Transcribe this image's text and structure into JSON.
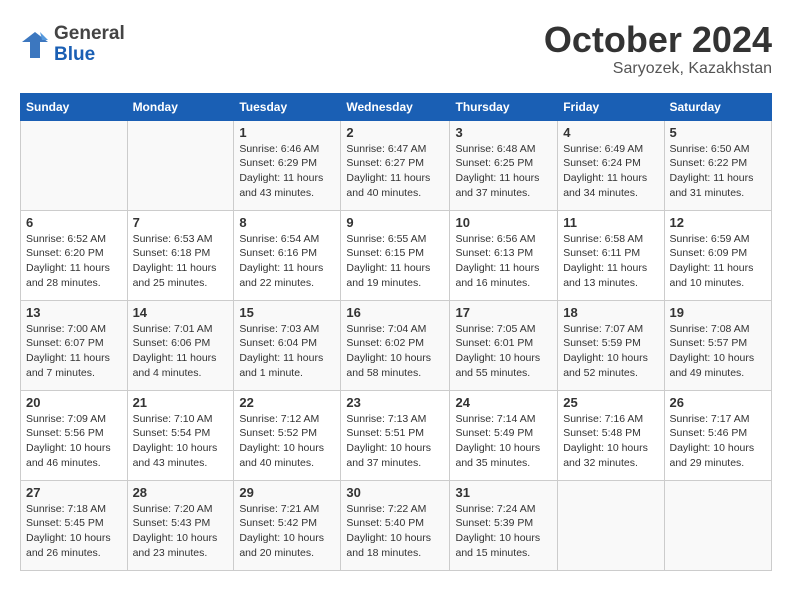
{
  "header": {
    "logo_general": "General",
    "logo_blue": "Blue",
    "month": "October 2024",
    "location": "Saryozek, Kazakhstan"
  },
  "weekdays": [
    "Sunday",
    "Monday",
    "Tuesday",
    "Wednesday",
    "Thursday",
    "Friday",
    "Saturday"
  ],
  "weeks": [
    [
      {
        "day": "",
        "info": ""
      },
      {
        "day": "",
        "info": ""
      },
      {
        "day": "1",
        "info": "Sunrise: 6:46 AM\nSunset: 6:29 PM\nDaylight: 11 hours and 43 minutes."
      },
      {
        "day": "2",
        "info": "Sunrise: 6:47 AM\nSunset: 6:27 PM\nDaylight: 11 hours and 40 minutes."
      },
      {
        "day": "3",
        "info": "Sunrise: 6:48 AM\nSunset: 6:25 PM\nDaylight: 11 hours and 37 minutes."
      },
      {
        "day": "4",
        "info": "Sunrise: 6:49 AM\nSunset: 6:24 PM\nDaylight: 11 hours and 34 minutes."
      },
      {
        "day": "5",
        "info": "Sunrise: 6:50 AM\nSunset: 6:22 PM\nDaylight: 11 hours and 31 minutes."
      }
    ],
    [
      {
        "day": "6",
        "info": "Sunrise: 6:52 AM\nSunset: 6:20 PM\nDaylight: 11 hours and 28 minutes."
      },
      {
        "day": "7",
        "info": "Sunrise: 6:53 AM\nSunset: 6:18 PM\nDaylight: 11 hours and 25 minutes."
      },
      {
        "day": "8",
        "info": "Sunrise: 6:54 AM\nSunset: 6:16 PM\nDaylight: 11 hours and 22 minutes."
      },
      {
        "day": "9",
        "info": "Sunrise: 6:55 AM\nSunset: 6:15 PM\nDaylight: 11 hours and 19 minutes."
      },
      {
        "day": "10",
        "info": "Sunrise: 6:56 AM\nSunset: 6:13 PM\nDaylight: 11 hours and 16 minutes."
      },
      {
        "day": "11",
        "info": "Sunrise: 6:58 AM\nSunset: 6:11 PM\nDaylight: 11 hours and 13 minutes."
      },
      {
        "day": "12",
        "info": "Sunrise: 6:59 AM\nSunset: 6:09 PM\nDaylight: 11 hours and 10 minutes."
      }
    ],
    [
      {
        "day": "13",
        "info": "Sunrise: 7:00 AM\nSunset: 6:07 PM\nDaylight: 11 hours and 7 minutes."
      },
      {
        "day": "14",
        "info": "Sunrise: 7:01 AM\nSunset: 6:06 PM\nDaylight: 11 hours and 4 minutes."
      },
      {
        "day": "15",
        "info": "Sunrise: 7:03 AM\nSunset: 6:04 PM\nDaylight: 11 hours and 1 minute."
      },
      {
        "day": "16",
        "info": "Sunrise: 7:04 AM\nSunset: 6:02 PM\nDaylight: 10 hours and 58 minutes."
      },
      {
        "day": "17",
        "info": "Sunrise: 7:05 AM\nSunset: 6:01 PM\nDaylight: 10 hours and 55 minutes."
      },
      {
        "day": "18",
        "info": "Sunrise: 7:07 AM\nSunset: 5:59 PM\nDaylight: 10 hours and 52 minutes."
      },
      {
        "day": "19",
        "info": "Sunrise: 7:08 AM\nSunset: 5:57 PM\nDaylight: 10 hours and 49 minutes."
      }
    ],
    [
      {
        "day": "20",
        "info": "Sunrise: 7:09 AM\nSunset: 5:56 PM\nDaylight: 10 hours and 46 minutes."
      },
      {
        "day": "21",
        "info": "Sunrise: 7:10 AM\nSunset: 5:54 PM\nDaylight: 10 hours and 43 minutes."
      },
      {
        "day": "22",
        "info": "Sunrise: 7:12 AM\nSunset: 5:52 PM\nDaylight: 10 hours and 40 minutes."
      },
      {
        "day": "23",
        "info": "Sunrise: 7:13 AM\nSunset: 5:51 PM\nDaylight: 10 hours and 37 minutes."
      },
      {
        "day": "24",
        "info": "Sunrise: 7:14 AM\nSunset: 5:49 PM\nDaylight: 10 hours and 35 minutes."
      },
      {
        "day": "25",
        "info": "Sunrise: 7:16 AM\nSunset: 5:48 PM\nDaylight: 10 hours and 32 minutes."
      },
      {
        "day": "26",
        "info": "Sunrise: 7:17 AM\nSunset: 5:46 PM\nDaylight: 10 hours and 29 minutes."
      }
    ],
    [
      {
        "day": "27",
        "info": "Sunrise: 7:18 AM\nSunset: 5:45 PM\nDaylight: 10 hours and 26 minutes."
      },
      {
        "day": "28",
        "info": "Sunrise: 7:20 AM\nSunset: 5:43 PM\nDaylight: 10 hours and 23 minutes."
      },
      {
        "day": "29",
        "info": "Sunrise: 7:21 AM\nSunset: 5:42 PM\nDaylight: 10 hours and 20 minutes."
      },
      {
        "day": "30",
        "info": "Sunrise: 7:22 AM\nSunset: 5:40 PM\nDaylight: 10 hours and 18 minutes."
      },
      {
        "day": "31",
        "info": "Sunrise: 7:24 AM\nSunset: 5:39 PM\nDaylight: 10 hours and 15 minutes."
      },
      {
        "day": "",
        "info": ""
      },
      {
        "day": "",
        "info": ""
      }
    ]
  ]
}
